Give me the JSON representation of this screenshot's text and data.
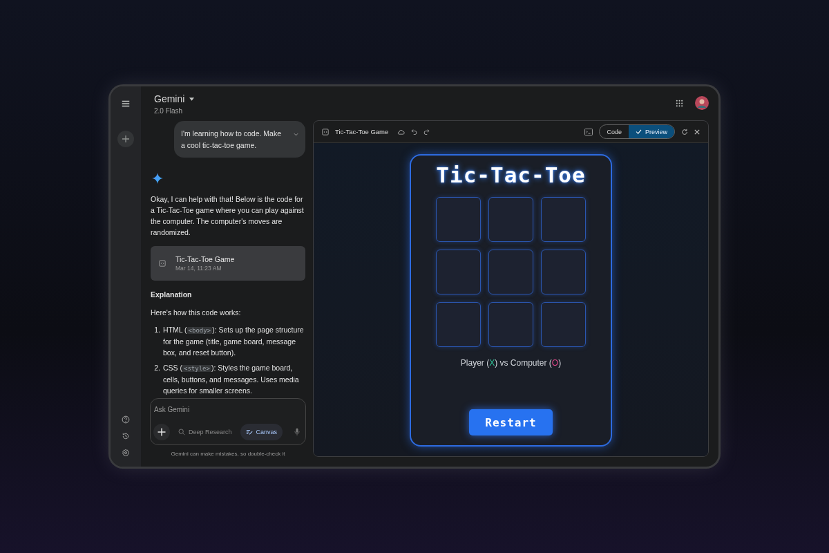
{
  "header": {
    "title": "Gemini",
    "model": "2.0 Flash"
  },
  "chat": {
    "prompt": "I'm learning how to code. Make a cool tic-tac-toe game.",
    "reply": "Okay, I can help with that! Below is the code for a Tic-Tac-Toe game where you can play against the computer. The computer's moves are randomized.",
    "doc_card": {
      "title": "Tic-Tac-Toe Game",
      "date": "Mar 14, 11:23 AM"
    },
    "heading": "Explanation",
    "intro": "Here's how this code works:",
    "steps": [
      {
        "number": "1.",
        "before": "HTML (",
        "code": "<body>",
        "after": "): Sets up the page structure for the game (title, game board, message box, and reset button)."
      },
      {
        "number": "2.",
        "before": "CSS (",
        "code": "<style>",
        "after": "): Styles the game board, cells, buttons, and messages. Uses media queries for smaller screens."
      }
    ]
  },
  "input": {
    "placeholder": "Ask Gemini",
    "tools": [
      {
        "label": "Deep Research",
        "selected": false
      },
      {
        "label": "Canvas",
        "selected": true
      }
    ]
  },
  "disclaimer": "Gemini can make mistakes, so double-check it",
  "canvas": {
    "title": "Tic-Tac-Toe Game",
    "view_tabs": [
      {
        "label": "Code",
        "selected": false
      },
      {
        "label": "Preview",
        "selected": true
      }
    ],
    "game": {
      "title": "Tic-Tac-Toe",
      "status": [
        {
          "text": "Player ("
        },
        {
          "text": "X",
          "color": "#2fc79a"
        },
        {
          "text": ") vs Computer ("
        },
        {
          "text": "O",
          "color": "#e0478a"
        },
        {
          "text": ")"
        }
      ],
      "button": "Restart"
    }
  }
}
